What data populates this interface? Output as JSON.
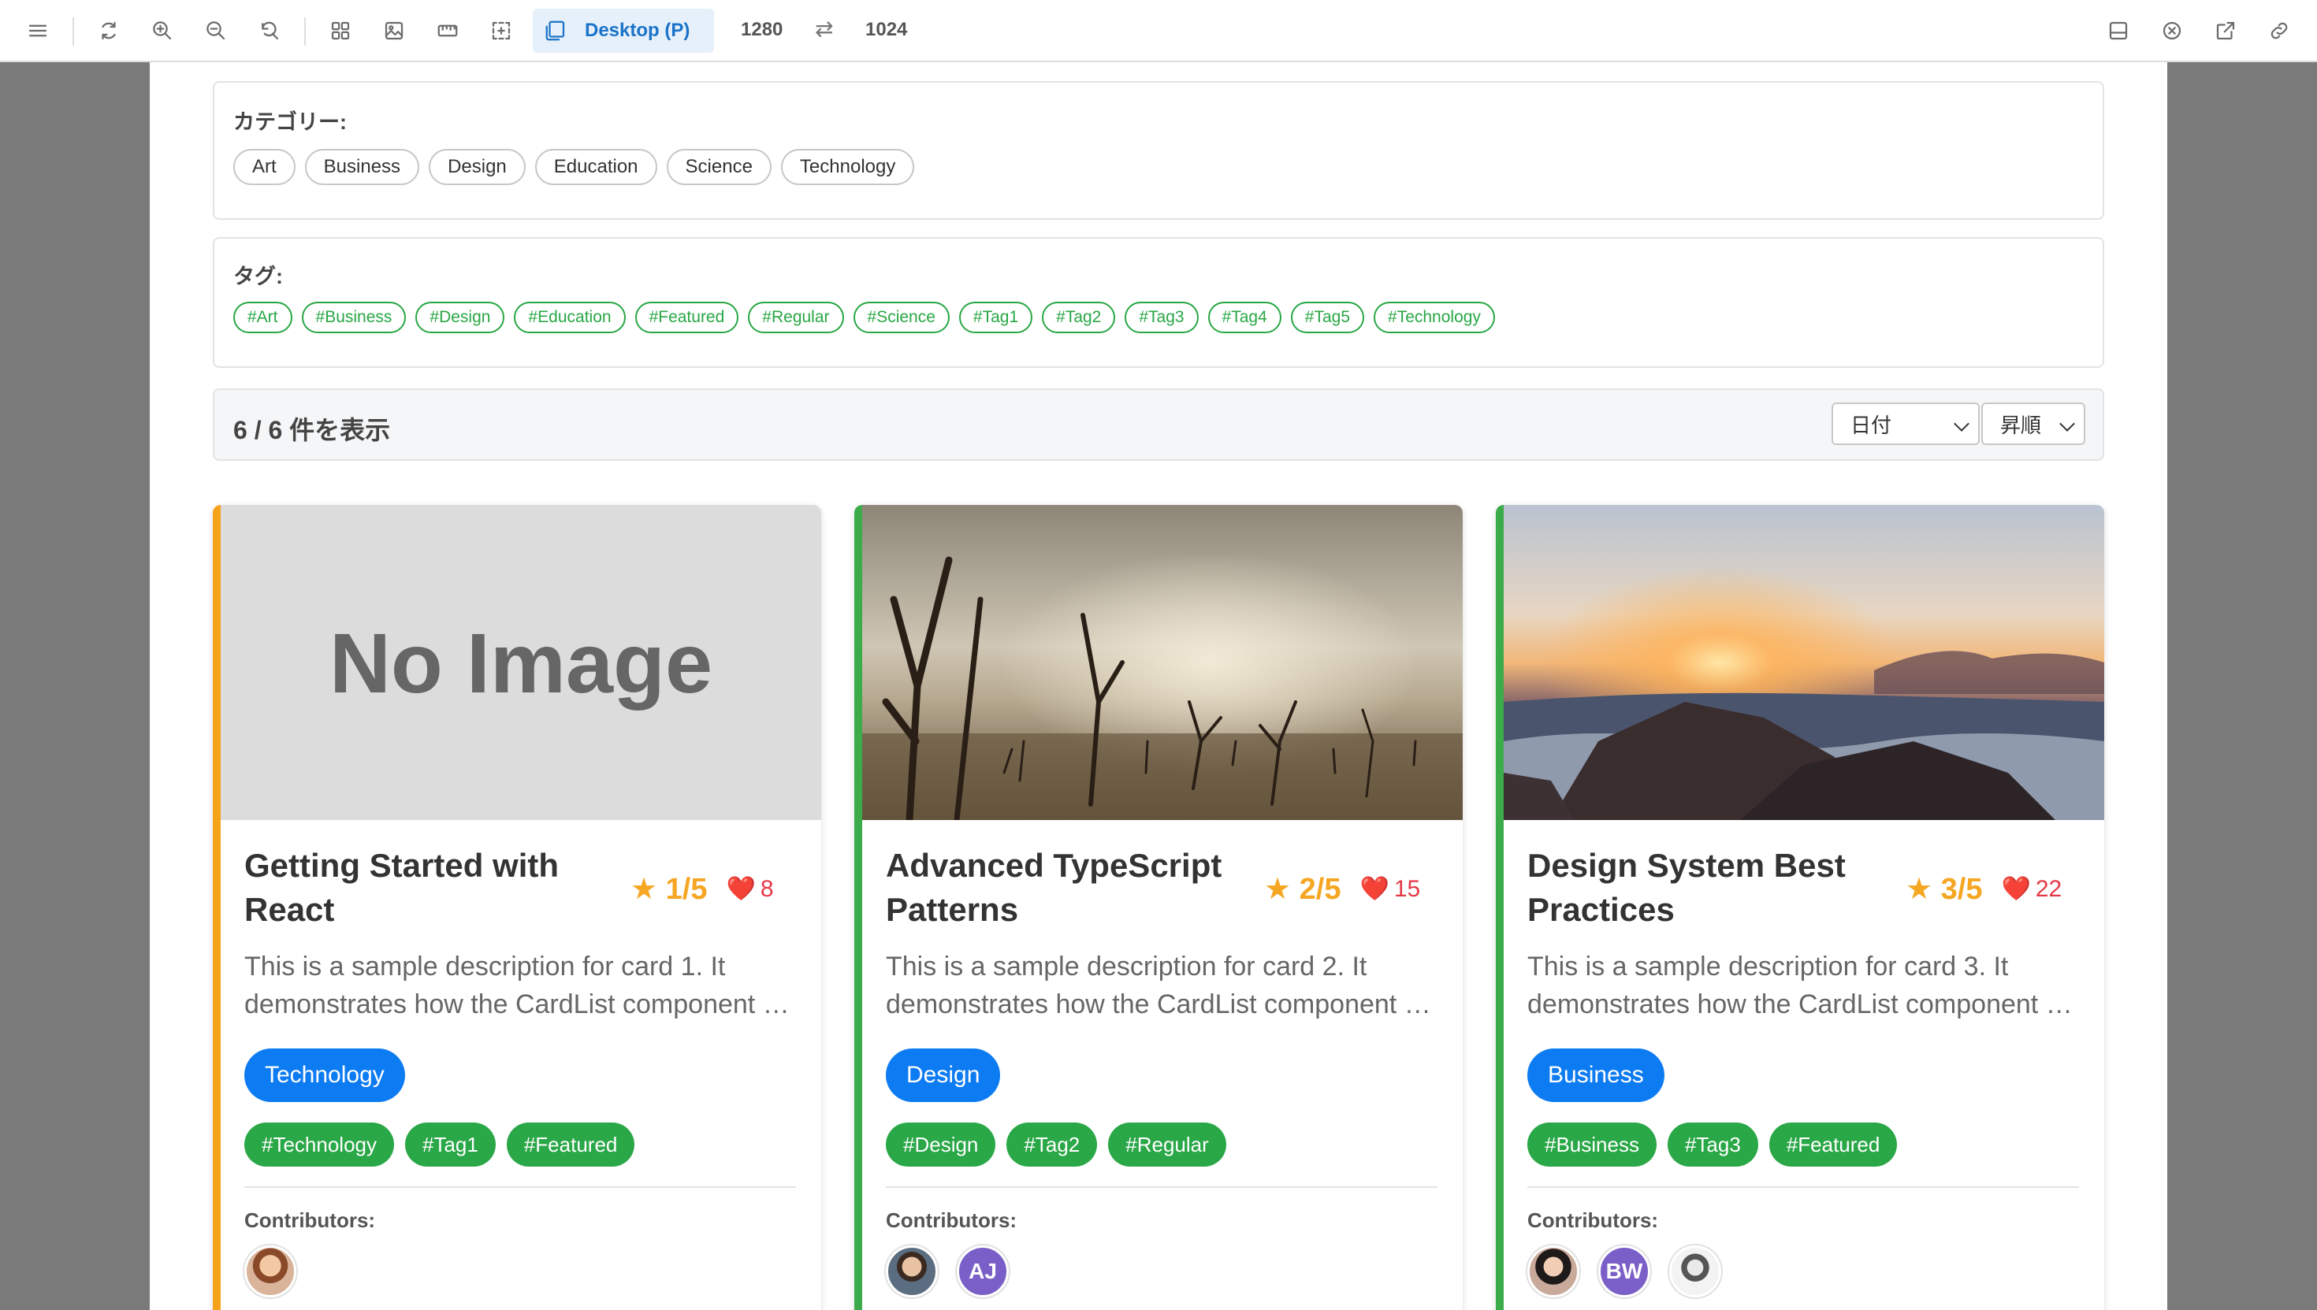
{
  "toolbar": {
    "device_label": "Desktop (P)",
    "width_value": "1280",
    "height_value": "1024",
    "swap_symbol": "⇄"
  },
  "categories_panel": {
    "title": "カテゴリー:",
    "items": [
      "Art",
      "Business",
      "Design",
      "Education",
      "Science",
      "Technology"
    ]
  },
  "tags_panel": {
    "title": "タグ:",
    "items": [
      "#Art",
      "#Business",
      "#Design",
      "#Education",
      "#Featured",
      "#Regular",
      "#Science",
      "#Tag1",
      "#Tag2",
      "#Tag3",
      "#Tag4",
      "#Tag5",
      "#Technology"
    ]
  },
  "results": {
    "count_text": "6 / 6 件を表示",
    "sort_field": "日付",
    "sort_order": "昇順"
  },
  "colors": {
    "accent_orange": "#f7a21b",
    "accent_green": "#3cab4a",
    "category_blue": "#0d7bf2",
    "tag_green": "#2aa747"
  },
  "cards": [
    {
      "accent": "#f7a21b",
      "image_text": "No Image",
      "title": "Getting Started with React",
      "rating": "★ 1/5",
      "heart": "❤️",
      "likes": "8",
      "desc_line1": "This is a sample description for card 1. It",
      "desc_line2": "demonstrates how the CardList component works",
      "category": "Technology",
      "tags": [
        "#Technology",
        "#Tag1",
        "#Featured"
      ],
      "contributors_label": "Contributors:",
      "contributors": [
        {
          "initials": ""
        }
      ]
    },
    {
      "accent": "#3cab4a",
      "title": "Advanced TypeScript Patterns",
      "rating": "★ 2/5",
      "heart": "❤️",
      "likes": "15",
      "desc_line1": "This is a sample description for card 2. It",
      "desc_line2": "demonstrates how the CardList component works",
      "category": "Design",
      "tags": [
        "#Design",
        "#Tag2",
        "#Regular"
      ],
      "contributors_label": "Contributors:",
      "contributors": [
        {
          "initials": ""
        },
        {
          "initials": "AJ"
        }
      ]
    },
    {
      "accent": "#3cab4a",
      "title": "Design System Best Practices",
      "rating": "★ 3/5",
      "heart": "❤️",
      "likes": "22",
      "desc_line1": "This is a sample description for card 3. It",
      "desc_line2": "demonstrates how the CardList component works",
      "category": "Business",
      "tags": [
        "#Business",
        "#Tag3",
        "#Featured"
      ],
      "contributors_label": "Contributors:",
      "contributors": [
        {
          "initials": ""
        },
        {
          "initials": "BW"
        },
        {
          "initials": ""
        }
      ]
    }
  ]
}
